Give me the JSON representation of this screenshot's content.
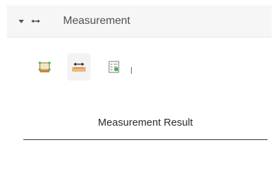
{
  "panel": {
    "title": "Measurement",
    "expanded": true,
    "header_icons": [
      "caret-down-icon",
      "distance-measure-icon"
    ]
  },
  "toolbar": {
    "tools": [
      {
        "name": "area-measure-icon",
        "active": false
      },
      {
        "name": "distance-measure-icon",
        "active": true
      },
      {
        "name": "location-measure-icon",
        "active": false
      }
    ],
    "separator": "|"
  },
  "result": {
    "heading": "Measurement Result"
  },
  "colors": {
    "accent_green": "#4CAF50",
    "ruler_orange": "#E08A2C",
    "header_bg": "#F6F6F6"
  }
}
